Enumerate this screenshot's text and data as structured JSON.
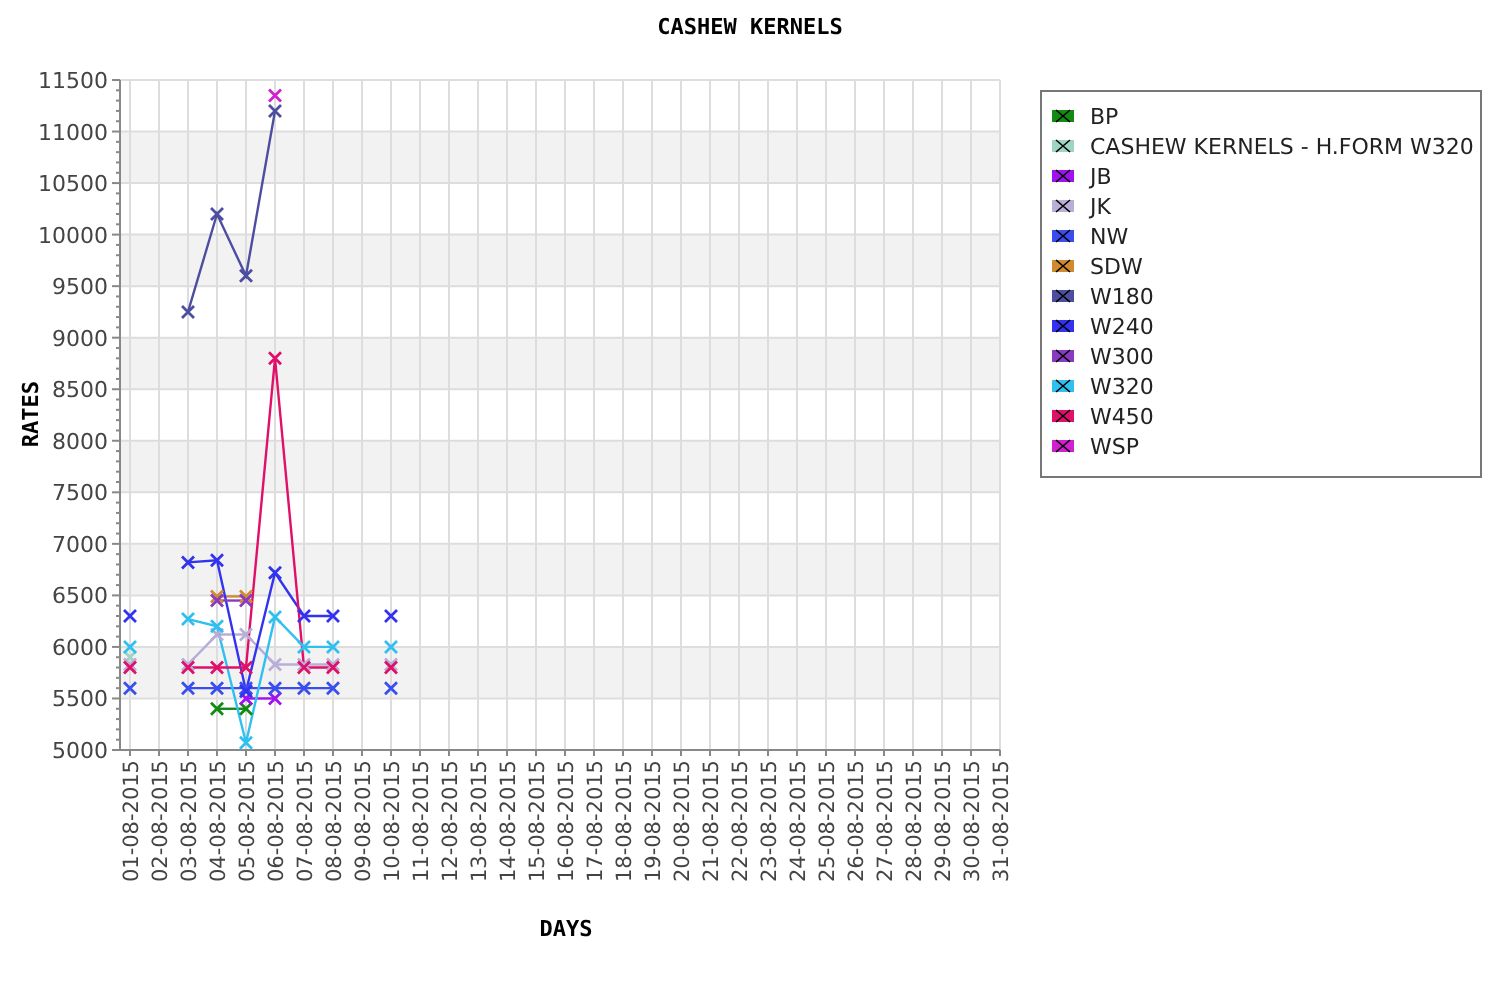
{
  "chart_data": {
    "type": "line",
    "title": "CASHEW KERNELS",
    "xlabel": "DAYS",
    "ylabel": "RATES",
    "categories": [
      "01-08-2015",
      "02-08-2015",
      "03-08-2015",
      "04-08-2015",
      "05-08-2015",
      "06-08-2015",
      "07-08-2015",
      "08-08-2015",
      "09-08-2015",
      "10-08-2015",
      "11-08-2015",
      "12-08-2015",
      "13-08-2015",
      "14-08-2015",
      "15-08-2015",
      "16-08-2015",
      "17-08-2015",
      "18-08-2015",
      "19-08-2015",
      "20-08-2015",
      "21-08-2015",
      "22-08-2015",
      "23-08-2015",
      "24-08-2015",
      "25-08-2015",
      "26-08-2015",
      "27-08-2015",
      "28-08-2015",
      "29-08-2015",
      "30-08-2015",
      "31-08-2015"
    ],
    "ylim": [
      5000,
      11500
    ],
    "grid": true,
    "legend": true,
    "yticks": [
      5000,
      5500,
      6000,
      6500,
      7000,
      7500,
      8000,
      8500,
      9000,
      9500,
      10000,
      10500,
      11000,
      11500
    ],
    "series": [
      {
        "name": "BP",
        "color": "#138a13",
        "marker": "cross",
        "values": [
          null,
          null,
          null,
          5400,
          5400,
          null,
          null,
          null,
          null,
          null,
          null,
          null,
          null,
          null,
          null,
          null,
          null,
          null,
          null,
          null,
          null,
          null,
          null,
          null,
          null,
          null,
          null,
          null,
          null,
          null,
          null
        ]
      },
      {
        "name": "CASHEW KERNELS - H.FORM W320",
        "color": "#9fd4c0",
        "marker": "cross",
        "values": [
          5900,
          null,
          null,
          null,
          null,
          null,
          null,
          null,
          null,
          null,
          null,
          null,
          null,
          null,
          null,
          null,
          null,
          null,
          null,
          null,
          null,
          null,
          null,
          null,
          null,
          null,
          null,
          null,
          null,
          null,
          null
        ]
      },
      {
        "name": "JB",
        "color": "#a010f0",
        "marker": "cross",
        "values": [
          null,
          null,
          null,
          null,
          5500,
          5500,
          null,
          null,
          null,
          null,
          null,
          null,
          null,
          null,
          null,
          null,
          null,
          null,
          null,
          null,
          null,
          null,
          null,
          null,
          null,
          null,
          null,
          null,
          null,
          null,
          null
        ]
      },
      {
        "name": "JK",
        "color": "#b9aed8",
        "marker": "cross",
        "values": [
          5830,
          null,
          5830,
          6120,
          6120,
          5830,
          5830,
          5830,
          null,
          5830,
          null,
          null,
          null,
          null,
          null,
          null,
          null,
          null,
          null,
          null,
          null,
          null,
          null,
          null,
          null,
          null,
          null,
          null,
          null,
          null,
          null
        ]
      },
      {
        "name": "NW",
        "color": "#3a4ef0",
        "marker": "cross",
        "values": [
          5600,
          null,
          5600,
          5600,
          5600,
          5600,
          5600,
          5600,
          null,
          5600,
          null,
          null,
          null,
          null,
          null,
          null,
          null,
          null,
          null,
          null,
          null,
          null,
          null,
          null,
          null,
          null,
          null,
          null,
          null,
          null,
          null
        ]
      },
      {
        "name": "SDW",
        "color": "#d08a30",
        "marker": "cross",
        "values": [
          null,
          null,
          null,
          6490,
          6490,
          null,
          null,
          null,
          null,
          null,
          null,
          null,
          null,
          null,
          null,
          null,
          null,
          null,
          null,
          null,
          null,
          null,
          null,
          null,
          null,
          null,
          null,
          null,
          null,
          null,
          null
        ]
      },
      {
        "name": "W180",
        "color": "#4e4ea0",
        "marker": "cross",
        "values": [
          null,
          null,
          9250,
          10200,
          9600,
          11200,
          null,
          null,
          null,
          null,
          null,
          null,
          null,
          null,
          null,
          null,
          null,
          null,
          null,
          null,
          null,
          null,
          null,
          null,
          null,
          null,
          null,
          null,
          null,
          null,
          null
        ]
      },
      {
        "name": "W240",
        "color": "#3232f0",
        "marker": "cross",
        "values": [
          6300,
          null,
          6820,
          6840,
          5570,
          6720,
          6300,
          6300,
          null,
          6300,
          null,
          null,
          null,
          null,
          null,
          null,
          null,
          null,
          null,
          null,
          null,
          null,
          null,
          null,
          null,
          null,
          null,
          null,
          null,
          null,
          null
        ]
      },
      {
        "name": "W300",
        "color": "#8a3ac0",
        "marker": "cross",
        "values": [
          null,
          null,
          null,
          6450,
          6450,
          null,
          null,
          null,
          null,
          null,
          null,
          null,
          null,
          null,
          null,
          null,
          null,
          null,
          null,
          null,
          null,
          null,
          null,
          null,
          null,
          null,
          null,
          null,
          null,
          null,
          null
        ]
      },
      {
        "name": "W320",
        "color": "#30c0f0",
        "marker": "cross",
        "values": [
          6000,
          null,
          6270,
          6200,
          5070,
          6290,
          6000,
          6000,
          null,
          6000,
          null,
          null,
          null,
          null,
          null,
          null,
          null,
          null,
          null,
          null,
          null,
          null,
          null,
          null,
          null,
          null,
          null,
          null,
          null,
          null,
          null
        ]
      },
      {
        "name": "W450",
        "color": "#e0106a",
        "marker": "cross",
        "values": [
          5800,
          null,
          5800,
          5800,
          5800,
          8800,
          5800,
          5800,
          null,
          5800,
          null,
          null,
          null,
          null,
          null,
          null,
          null,
          null,
          null,
          null,
          null,
          null,
          null,
          null,
          null,
          null,
          null,
          null,
          null,
          null,
          null
        ]
      },
      {
        "name": "WSP",
        "color": "#d020d0",
        "marker": "cross",
        "values": [
          null,
          null,
          null,
          null,
          null,
          11350,
          null,
          null,
          null,
          null,
          null,
          null,
          null,
          null,
          null,
          null,
          null,
          null,
          null,
          null,
          null,
          null,
          null,
          null,
          null,
          null,
          null,
          null,
          null,
          null,
          null
        ]
      }
    ]
  }
}
